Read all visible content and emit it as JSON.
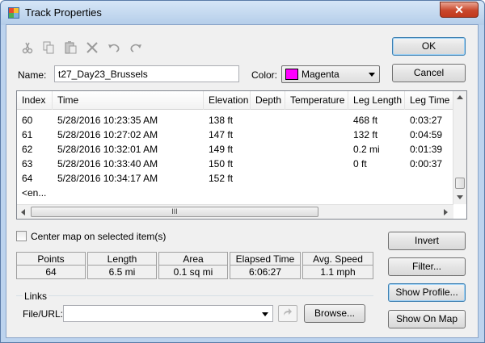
{
  "window": {
    "title": "Track Properties",
    "close_glyph": "✕"
  },
  "toolbar": {
    "icons": [
      "cut-icon",
      "copy-icon",
      "paste-icon",
      "delete-icon",
      "undo-icon",
      "redo-icon"
    ]
  },
  "buttons": {
    "ok": "OK",
    "cancel": "Cancel",
    "invert": "Invert",
    "filter": "Filter...",
    "show_profile": "Show Profile...",
    "show_on_map": "Show On Map",
    "browse": "Browse..."
  },
  "name_field": {
    "label": "Name:",
    "value": "t27_Day23_Brussels"
  },
  "color_field": {
    "label": "Color:",
    "value": "Magenta",
    "swatch": "#ff00ff"
  },
  "grid": {
    "columns": [
      "Index",
      "Time",
      "Elevation",
      "Depth",
      "Temperature",
      "Leg Length",
      "Leg Time"
    ],
    "rows": [
      [
        "60",
        "5/28/2016 10:23:35 AM",
        "138 ft",
        "",
        "",
        "468 ft",
        "0:03:27"
      ],
      [
        "61",
        "5/28/2016 10:27:02 AM",
        "147 ft",
        "",
        "",
        "132 ft",
        "0:04:59"
      ],
      [
        "62",
        "5/28/2016 10:32:01 AM",
        "149 ft",
        "",
        "",
        "0.2 mi",
        "0:01:39"
      ],
      [
        "63",
        "5/28/2016 10:33:40 AM",
        "150 ft",
        "",
        "",
        "0 ft",
        "0:00:37"
      ],
      [
        "64",
        "5/28/2016 10:34:17 AM",
        "152 ft",
        "",
        "",
        "",
        ""
      ]
    ],
    "end_marker": "<en...",
    "hscroll_grip": "III"
  },
  "center_map": {
    "label": "Center map on selected item(s)",
    "checked": false
  },
  "stats": {
    "headers": [
      "Points",
      "Length",
      "Area",
      "Elapsed Time",
      "Avg. Speed"
    ],
    "values": [
      "64",
      "6.5 mi",
      "0.1 sq mi",
      "6:06:27",
      "1.1 mph"
    ]
  },
  "links": {
    "group_label": "Links",
    "url_label": "File/URL:",
    "url_value": ""
  }
}
